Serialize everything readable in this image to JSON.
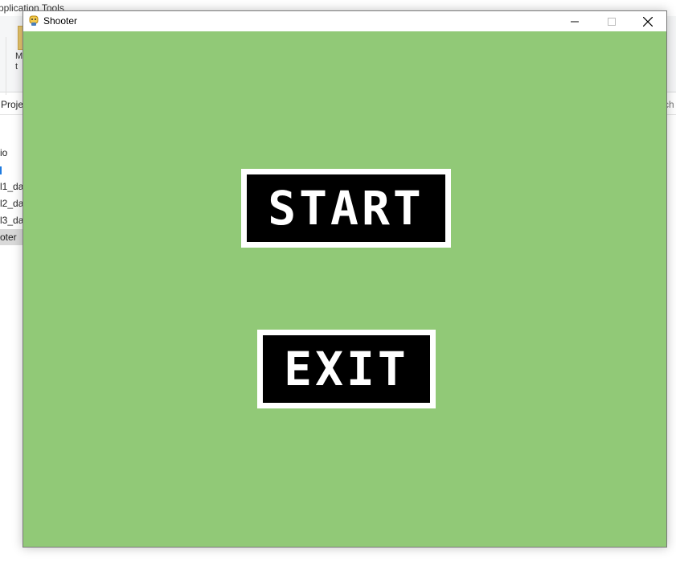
{
  "background_window": {
    "ribbon_title": "pplication Tools",
    "ribbon_button_label": "M\nt",
    "address_text": "Proje",
    "search_text": "ch",
    "nav_items": [
      "io",
      "",
      "l1_da",
      "l2_da",
      "l3_da",
      "oter"
    ]
  },
  "window": {
    "title": "Shooter",
    "icon": "pygame-snake-icon",
    "controls": {
      "minimize_icon": "minimize-icon",
      "maximize_icon": "maximize-icon",
      "close_icon": "close-icon"
    }
  },
  "game": {
    "background_color": "#91c977",
    "start_label": "START",
    "exit_label": "EXIT",
    "button_fill": "#000000",
    "button_border": "#ffffff"
  }
}
